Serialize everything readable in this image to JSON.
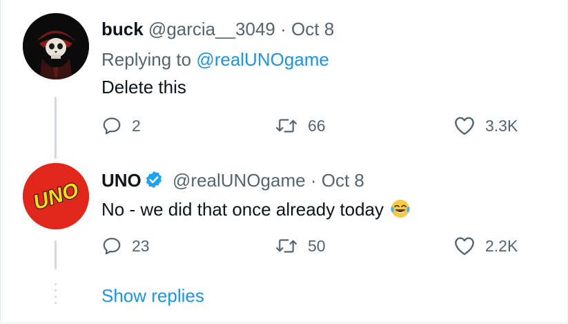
{
  "tweets": [
    {
      "name": "buck",
      "handle": "@garcia__3049",
      "separator": "·",
      "date": "Oct 8",
      "replying_prefix": "Replying to",
      "replying_to": "@realUNOgame",
      "text": "Delete this",
      "replies": "2",
      "retweets": "66",
      "likes": "3.3K",
      "avatar_icon": "skull-avatar-icon"
    },
    {
      "name": "UNO",
      "verified": true,
      "handle": "@realUNOgame",
      "separator": "·",
      "date": "Oct 8",
      "text": "No - we did that once already today",
      "emoji": "face-with-tears-of-joy-icon",
      "replies": "23",
      "retweets": "50",
      "likes": "2.2K",
      "avatar_icon": "uno-logo-avatar-icon",
      "avatar_logo_text": "UNO"
    }
  ],
  "show_replies_label": "Show replies",
  "colors": {
    "link": "#1b95e0",
    "muted": "#536471",
    "uno_red": "#e1261c",
    "uno_yellow": "#f9d71c",
    "verified": "#1da1f2"
  }
}
